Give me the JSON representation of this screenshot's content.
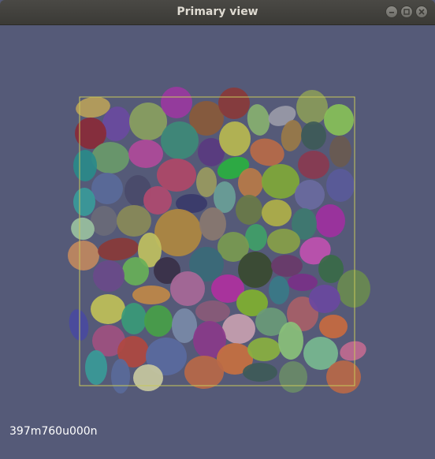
{
  "window": {
    "title": "Primary view",
    "buttons": [
      "minimize",
      "maximize",
      "close"
    ]
  },
  "overlay": {
    "line1": "",
    "line2": "",
    "time": "397m760u000n"
  },
  "colors": {
    "background": "#555a78",
    "bounding_box": "#c8c85a"
  }
}
